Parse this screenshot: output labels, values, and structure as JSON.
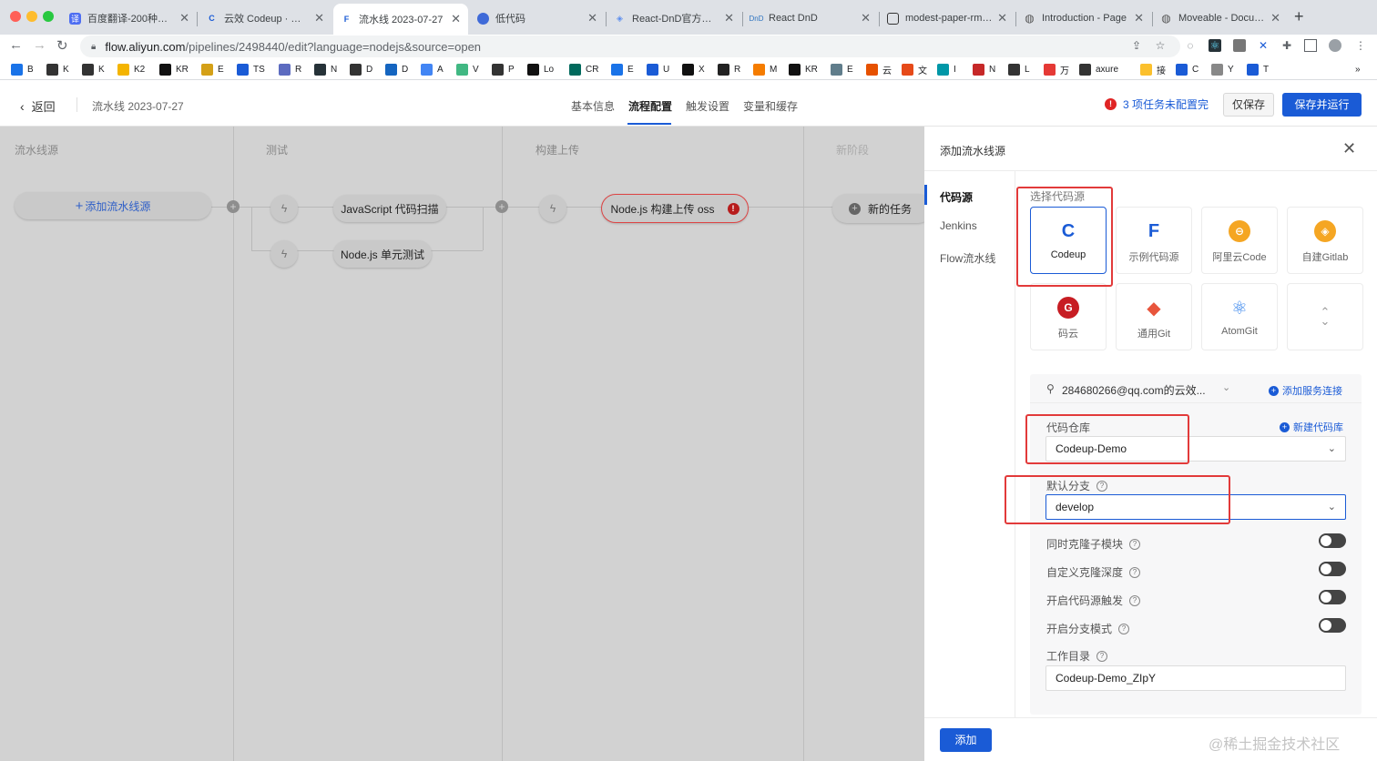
{
  "browser": {
    "tabs": [
      {
        "title": "百度翻译-200种语言",
        "color": "#4e6ef2"
      },
      {
        "title": "云效 Codeup · 企业级",
        "color": "#1a5bd6"
      },
      {
        "title": "流水线 2023-07-27",
        "color": "#1a5bd6"
      },
      {
        "title": "低代码",
        "color": "#3f6ad8"
      },
      {
        "title": "React-DnD官方文档",
        "color": "#5b8def"
      },
      {
        "title": "React DnD",
        "color": "#2f74c0"
      },
      {
        "title": "modest-paper-rmp9k",
        "color": "#333333"
      },
      {
        "title": "Introduction - Page",
        "color": "#555555"
      },
      {
        "title": "Moveable - Docume",
        "color": "#555555"
      }
    ],
    "url_host": "flow.aliyun.com",
    "url_path": "/pipelines/2498440/edit?language=nodejs&source=open",
    "bookmarks": [
      "B",
      "K",
      "K",
      "K2",
      "KR",
      "E",
      "TS",
      "R",
      "N",
      "D",
      "D",
      "A",
      "V",
      "P",
      "Lo",
      "CR",
      "E",
      "U",
      "X",
      "R",
      "M",
      "KR",
      "E",
      "云",
      "文",
      "I",
      "N",
      "L",
      "万",
      "axure",
      "接",
      "C",
      "Y",
      "T"
    ]
  },
  "header": {
    "back_label": "返回",
    "title": "流水线 2023-07-27",
    "tabs": [
      "基本信息",
      "流程配置",
      "触发设置",
      "变量和缓存"
    ],
    "warning": "3 项任务未配置完",
    "save_only": "仅保存",
    "save_run": "保存并运行"
  },
  "canvas": {
    "stages": [
      "流水线源",
      "测试",
      "构建上传",
      "新阶段"
    ],
    "add_source_label": "添加流水线源",
    "tasks": {
      "js_scan": "JavaScript 代码扫描",
      "node_test": "Node.js 单元测试",
      "node_oss": "Node.js 构建上传 oss",
      "new_task": "新的任务"
    }
  },
  "panel": {
    "title": "添加流水线源",
    "sidebar": [
      "代码源",
      "Jenkins",
      "Flow流水线"
    ],
    "select_label": "选择代码源",
    "sources": [
      {
        "label": "Codeup",
        "color": "#1a5bd6",
        "glyph": "C"
      },
      {
        "label": "示例代码源",
        "color": "#1a5bd6",
        "glyph": "F"
      },
      {
        "label": "阿里云Code",
        "color": "#f5a623",
        "glyph": "⊖"
      },
      {
        "label": "自建Gitlab",
        "color": "#f5a623",
        "glyph": "◈"
      },
      {
        "label": "码云",
        "color": "#c71d23",
        "glyph": "G"
      },
      {
        "label": "通用Git",
        "color": "#e8553c",
        "glyph": "◆"
      },
      {
        "label": "AtomGit",
        "color": "#2f80ed",
        "glyph": "⚛"
      }
    ],
    "account": "284680266@qq.com的云效...",
    "add_service": "添加服务连接",
    "repo_label": "代码仓库",
    "new_repo": "新建代码库",
    "repo_value": "Codeup-Demo",
    "branch_label": "默认分支",
    "branch_value": "develop",
    "toggles": [
      "同时克隆子模块",
      "自定义克隆深度",
      "开启代码源触发",
      "开启分支模式"
    ],
    "workdir_label": "工作目录",
    "workdir_value": "Codeup-Demo_ZIpY",
    "add_button": "添加",
    "watermark": "@稀土掘金技术社区"
  }
}
